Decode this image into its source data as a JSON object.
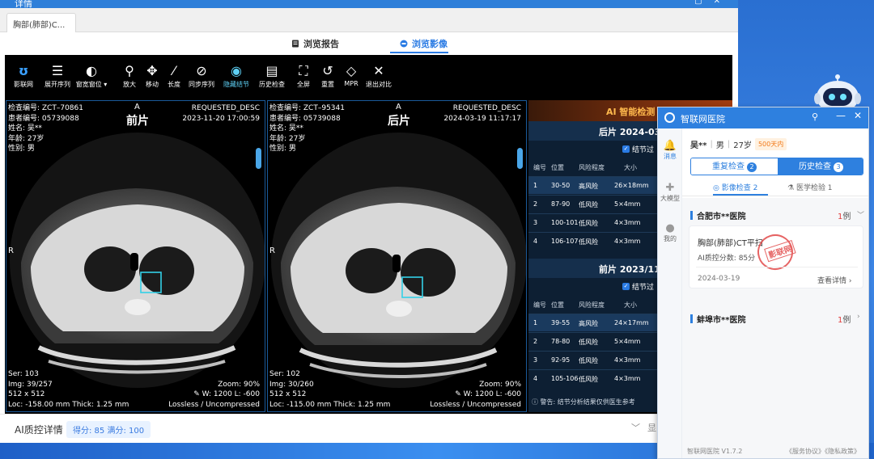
{
  "window": {
    "title": "详情",
    "doc_tab": "胸部(肺部)C..."
  },
  "view_switch": {
    "report_label": "浏览报告",
    "image_label": "浏览影像"
  },
  "toolbar": [
    {
      "icon": "logo-icon",
      "glyph": "ʊ",
      "label": "影联网"
    },
    {
      "icon": "list-icon",
      "glyph": "☰",
      "label": "展开序列"
    },
    {
      "icon": "contrast-icon",
      "glyph": "◐",
      "label": "窗宽窗位 ▾"
    },
    {
      "icon": "zoom-icon",
      "glyph": "⚲",
      "label": "放大"
    },
    {
      "icon": "move-icon",
      "glyph": "✥",
      "label": "移动"
    },
    {
      "icon": "ruler-icon",
      "glyph": "⁄",
      "label": "长度"
    },
    {
      "icon": "link-icon",
      "glyph": "⊘",
      "label": "同步序列"
    },
    {
      "icon": "eye-icon",
      "glyph": "◉",
      "label": "隐藏结节"
    },
    {
      "icon": "history-icon",
      "glyph": "▤",
      "label": "历史检查"
    },
    {
      "icon": "fullscreen-icon",
      "glyph": "⛶",
      "label": "全屏"
    },
    {
      "icon": "reset-icon",
      "glyph": "↺",
      "label": "重置"
    },
    {
      "icon": "mpr-icon",
      "glyph": "◇",
      "label": "MPR"
    },
    {
      "icon": "close-icon",
      "glyph": "✕",
      "label": "退出对比"
    }
  ],
  "left_pane": {
    "exam_no": "检查编号: ZCT–70861",
    "patient_no": "患者编号: 05739088",
    "name": "姓名: 吴**",
    "age": "年龄: 27岁",
    "sex": "性别: 男",
    "orientation_top": "A",
    "orientation_left": "R",
    "phase": "前片",
    "desc": "REQUESTED_DESC",
    "datetime": "2023-11-20 17:00:59",
    "ser": "Ser: 103",
    "img": "Img: 39/257",
    "matrix": "512 x 512",
    "loc": "Loc: -158.00 mm Thick: 1.25 mm",
    "zoom": "Zoom: 90%",
    "wl": "W: 1200 L: -600",
    "compression": "Lossless / Uncompressed"
  },
  "right_pane": {
    "exam_no": "检查编号: ZCT–95341",
    "patient_no": "患者编号: 05739088",
    "name": "姓名: 吴**",
    "age": "年龄: 27岁",
    "sex": "性别: 男",
    "orientation_top": "A",
    "orientation_left": "R",
    "phase": "后片",
    "desc": "REQUESTED_DESC",
    "datetime": "2024-03-19 11:17:17",
    "ser": "Ser: 102",
    "img": "Img: 30/260",
    "matrix": "512 x 512",
    "loc": "Loc: -115.00 mm Thick: 1.25 mm",
    "zoom": "Zoom: 90%",
    "wl": "W: 1200 L: -600",
    "compression": "Lossless / Uncompressed"
  },
  "ai_panel": {
    "title": "AI 智能检测",
    "filter_label": "结节过",
    "columns": [
      "编号",
      "位置",
      "风险程度",
      "大小"
    ],
    "sections": [
      {
        "heading": "后片  2024-03/",
        "rows": [
          [
            "1",
            "30-50",
            "高风险",
            "26×18mm"
          ],
          [
            "2",
            "87-90",
            "低风险",
            "5×4mm"
          ],
          [
            "3",
            "100-101",
            "低风险",
            "4×3mm"
          ],
          [
            "4",
            "106-107",
            "低风险",
            "4×3mm"
          ]
        ]
      },
      {
        "heading": "前片  2023/11/",
        "rows": [
          [
            "1",
            "39-55",
            "高风险",
            "24×17mm"
          ],
          [
            "2",
            "78-80",
            "低风险",
            "5×4mm"
          ],
          [
            "3",
            "92-95",
            "低风险",
            "4×3mm"
          ],
          [
            "4",
            "105-106",
            "低风险",
            "4×3mm"
          ]
        ]
      }
    ],
    "note": "警告: 结节分析结果仅供医生参考"
  },
  "bottom": {
    "qc_label": "AI质控详情",
    "qc_score": "得分: 85 满分: 100",
    "toggle": "显"
  },
  "side": {
    "title": "智联网医院",
    "rail": [
      {
        "icon": "bell-icon",
        "glyph": "🔔",
        "label": "消息"
      },
      {
        "icon": "cross-icon",
        "glyph": "✚",
        "label": "大模型"
      },
      {
        "icon": "user-icon",
        "glyph": "●",
        "label": "我的"
      }
    ],
    "patient": {
      "name": "吴**",
      "sex": "男",
      "age": "27岁",
      "days": "500天内"
    },
    "segments": [
      {
        "label": "重复检查",
        "count": "2"
      },
      {
        "label": "历史检查",
        "count": "3"
      }
    ],
    "subtabs": {
      "imaging": "影像检查 2",
      "lab": "医学检验 1"
    },
    "hospitals": [
      {
        "name": "合肥市**医院",
        "count": "1",
        "unit": "例",
        "arrow": "﹀"
      },
      {
        "name": "蚌埠市**医院",
        "count": "1",
        "unit": "例",
        "arrow": "›"
      }
    ],
    "exam": {
      "name": "胸部(肺部)CT平扫",
      "score": "AI质控分数: 85分",
      "date": "2024-03-19",
      "detail": "查看详情 ›",
      "stamp": "影联网"
    },
    "footer": {
      "version": "智联网医院 V1.7.2",
      "links": "《服务协议》《隐私政策》"
    }
  }
}
